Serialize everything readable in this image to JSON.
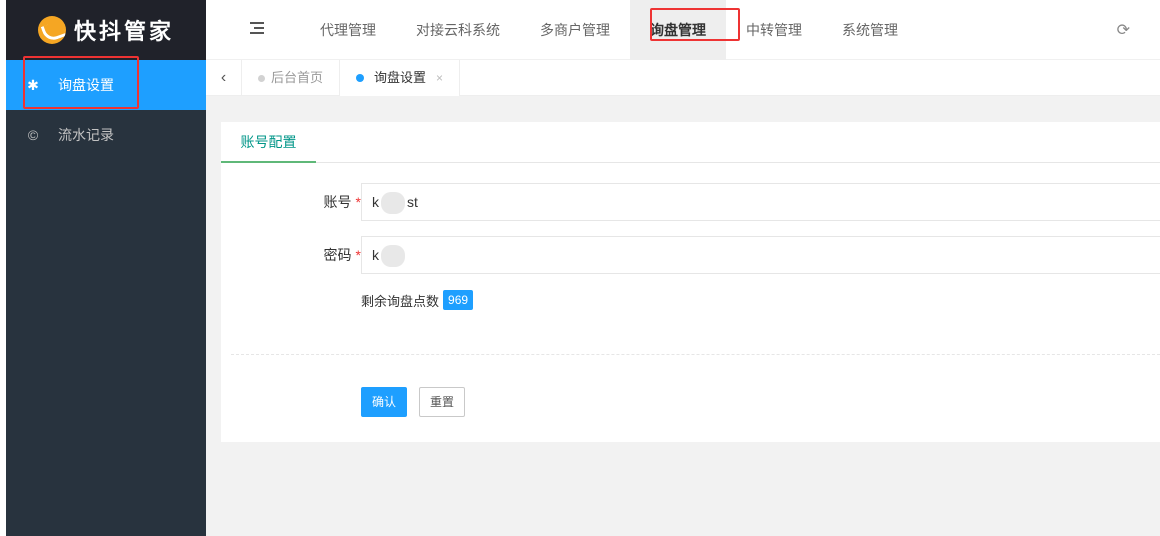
{
  "app": {
    "logo_text": "快抖管家"
  },
  "sidebar": {
    "items": [
      {
        "label": "询盘设置",
        "icon": "asterisk-icon"
      },
      {
        "label": "流水记录",
        "icon": "copyright-icon"
      }
    ]
  },
  "header": {
    "nav": [
      "代理管理",
      "对接云科系统",
      "多商户管理",
      "询盘管理",
      "中转管理",
      "系统管理"
    ],
    "active_nav": "询盘管理"
  },
  "tabs": {
    "home": "后台首页",
    "current": "询盘设置",
    "close_glyph": "×"
  },
  "panel": {
    "tab_label": "账号配置",
    "account": {
      "label": "账号",
      "value_prefix": "k",
      "value_suffix": "st"
    },
    "password": {
      "label": "密码",
      "value_prefix": "k"
    },
    "remaining_label": "剩余询盘点数",
    "remaining_count": "969",
    "confirm_label": "确认",
    "reset_label": "重置"
  },
  "colors": {
    "accent": "#1e9fff",
    "sidebar_bg": "#28333e",
    "highlight": "#ee3333",
    "tab_active": "#009688"
  }
}
